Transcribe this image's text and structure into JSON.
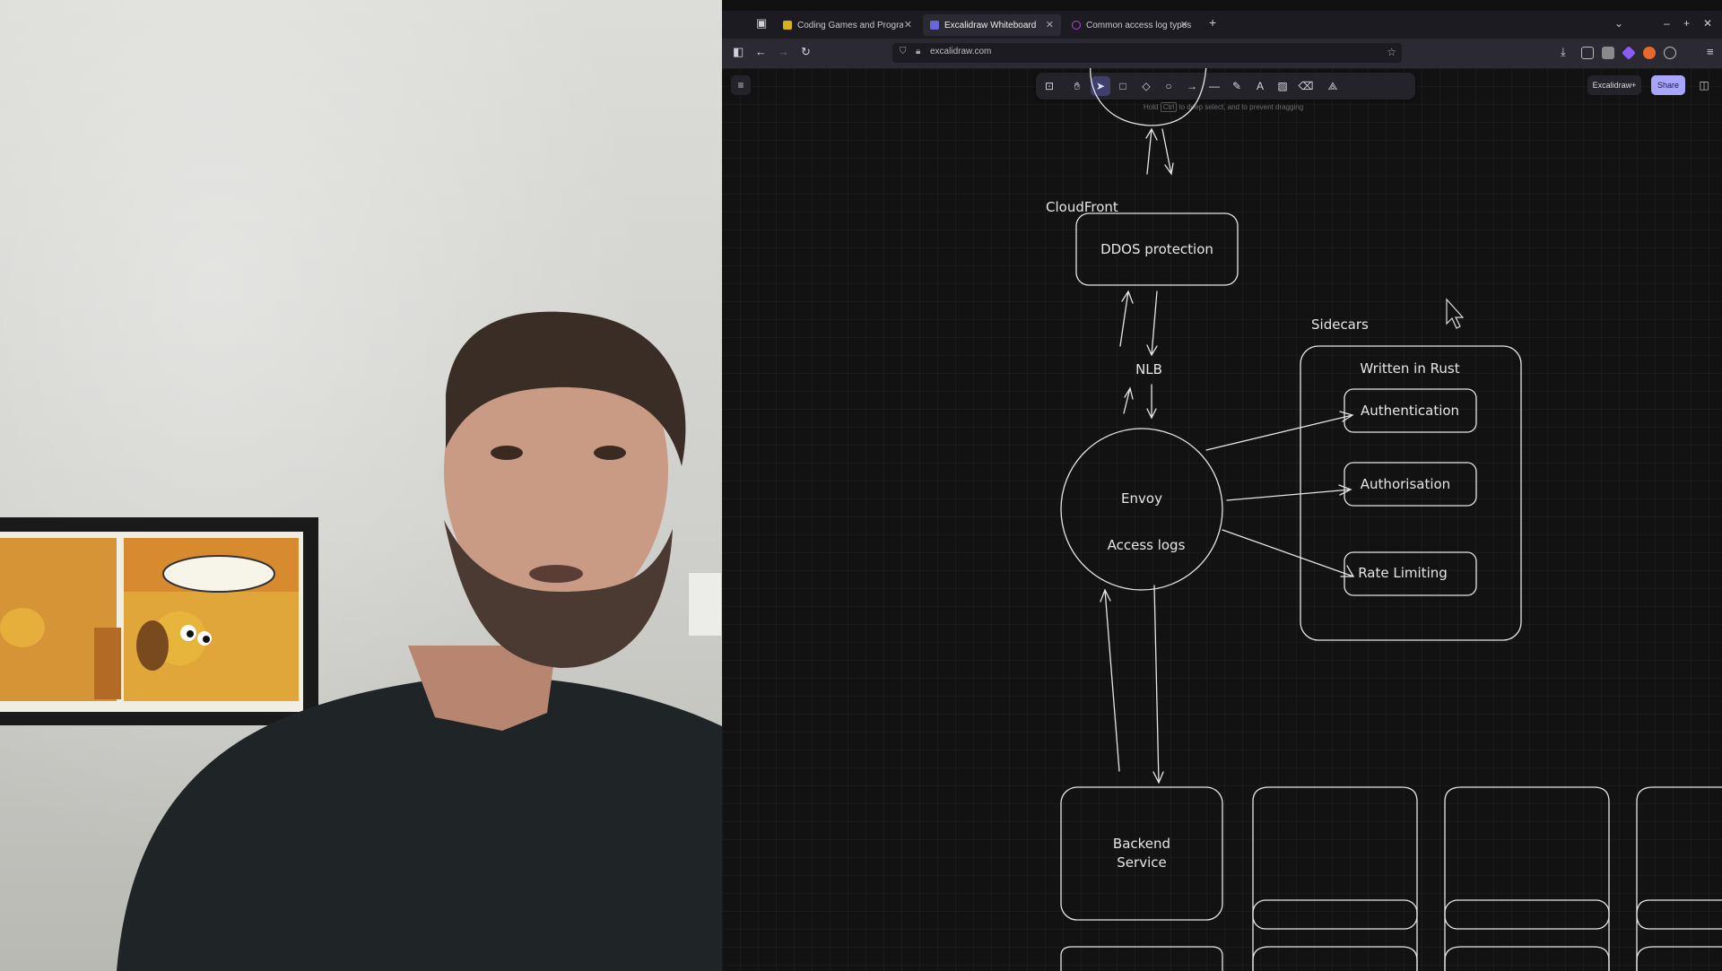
{
  "tabs": [
    {
      "label": "Coding Games and Program",
      "favicon_color": "#d7b21c"
    },
    {
      "label": "Excalidraw Whiteboard",
      "favicon_color": "#6965db"
    },
    {
      "label": "Common access log types",
      "favicon_color": "#b14bd1"
    }
  ],
  "url": "excalidraw.com",
  "toolbar": {
    "hint_pre": "Hold",
    "hint_key": "Ctrl",
    "hint_post": "to deep select, and to prevent dragging",
    "active_tool": "selection"
  },
  "buttons": {
    "library": "Excalidraw+",
    "share": "Share"
  },
  "diagram": {
    "cloudfront_label": "CloudFront",
    "ddos_label": "DDOS protection",
    "nlb_label": "NLB",
    "sidecars_label": "Sidecars",
    "written_in_rust_label": "Written in Rust",
    "authentication_label": "Authentication",
    "authorisation_label": "Authorisation",
    "rate_limiting_label": "Rate Limiting",
    "envoy_label": "Envoy",
    "access_logs_label": "Access logs",
    "backend_line1": "Backend",
    "backend_line2": "Service"
  },
  "colors": {
    "canvas_bg": "#121212",
    "stroke": "#e6e6e6",
    "active_tool": "#403e6a",
    "share": "#a8a5ff"
  }
}
